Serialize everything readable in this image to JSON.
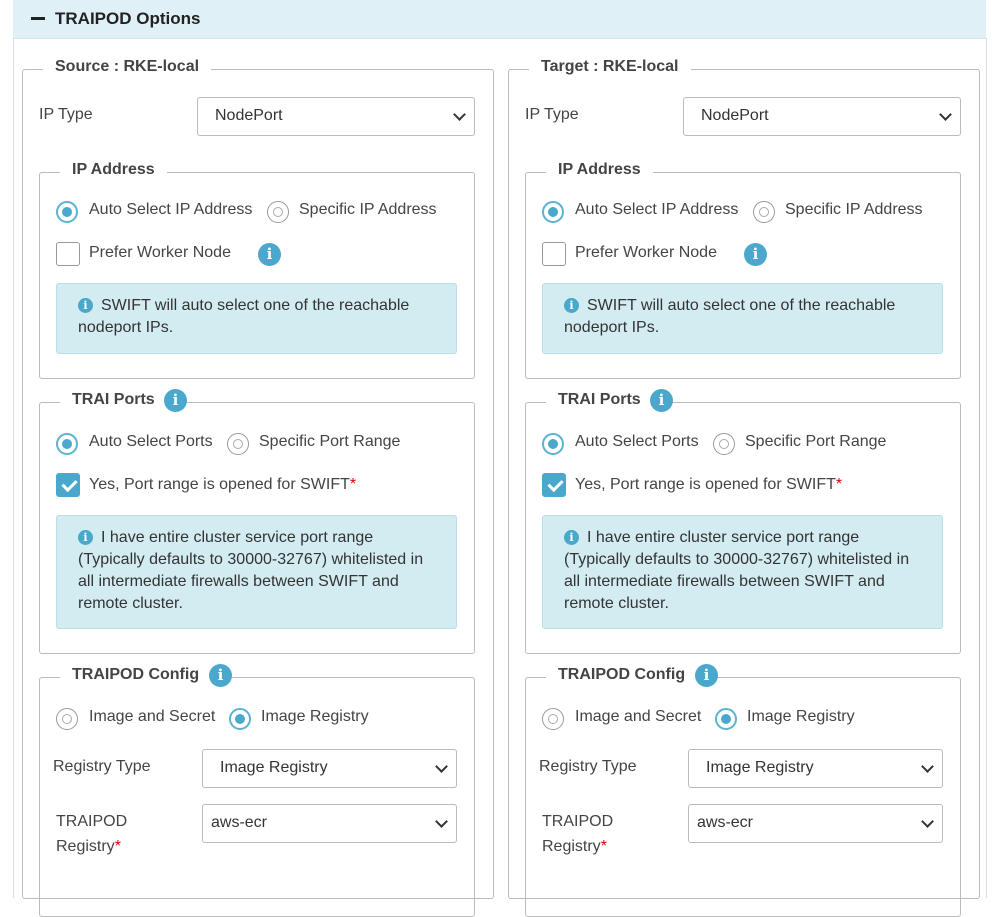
{
  "section_title": "TRAIPOD Options",
  "colors": {
    "accent": "#4aa8cc",
    "header_bg": "#dff1f7",
    "alert_bg": "#d2ecf2",
    "required": "#dd0000"
  },
  "columns": [
    {
      "legend": "Source : RKE-local",
      "ip_type": {
        "label": "IP Type",
        "value": "NodePort"
      },
      "ip_address": {
        "legend": "IP Address",
        "opt_auto": "Auto Select IP Address",
        "opt_specific": "Specific IP Address",
        "selected": "auto",
        "prefer_worker": "Prefer Worker Node",
        "prefer_worker_checked": false,
        "alert": "SWIFT will auto select one of the reachable nodeport IPs."
      },
      "ports": {
        "legend": "TRAI Ports",
        "opt_auto": "Auto Select Ports",
        "opt_specific": "Specific Port Range",
        "selected": "auto",
        "confirm": "Yes, Port range is opened for SWIFT",
        "confirm_checked": true,
        "alert": "I have entire cluster service port range (Typically defaults to 30000-32767) whitelisted in all intermediate firewalls between SWIFT and remote cluster."
      },
      "config": {
        "legend": "TRAIPOD Config",
        "opt_image_secret": "Image and Secret",
        "opt_registry": "Image Registry",
        "selected": "registry",
        "registry_type_label": "Registry Type",
        "registry_type_value": "Image Registry",
        "registry_label_1": "TRAIPOD",
        "registry_label_2": "Registry",
        "registry_value": "aws-ecr"
      }
    },
    {
      "legend": "Target : RKE-local",
      "ip_type": {
        "label": "IP Type",
        "value": "NodePort"
      },
      "ip_address": {
        "legend": "IP Address",
        "opt_auto": "Auto Select IP Address",
        "opt_specific": "Specific IP Address",
        "selected": "auto",
        "prefer_worker": "Prefer Worker Node",
        "prefer_worker_checked": false,
        "alert": "SWIFT will auto select one of the reachable nodeport IPs."
      },
      "ports": {
        "legend": "TRAI Ports",
        "opt_auto": "Auto Select Ports",
        "opt_specific": "Specific Port Range",
        "selected": "auto",
        "confirm": "Yes, Port range is opened for SWIFT",
        "confirm_checked": true,
        "alert": "I have entire cluster service port range (Typically defaults to 30000-32767) whitelisted in all intermediate firewalls between SWIFT and remote cluster."
      },
      "config": {
        "legend": "TRAIPOD Config",
        "opt_image_secret": "Image and Secret",
        "opt_registry": "Image Registry",
        "selected": "registry",
        "registry_type_label": "Registry Type",
        "registry_type_value": "Image Registry",
        "registry_label_1": "TRAIPOD",
        "registry_label_2": "Registry",
        "registry_value": "aws-ecr"
      }
    }
  ]
}
